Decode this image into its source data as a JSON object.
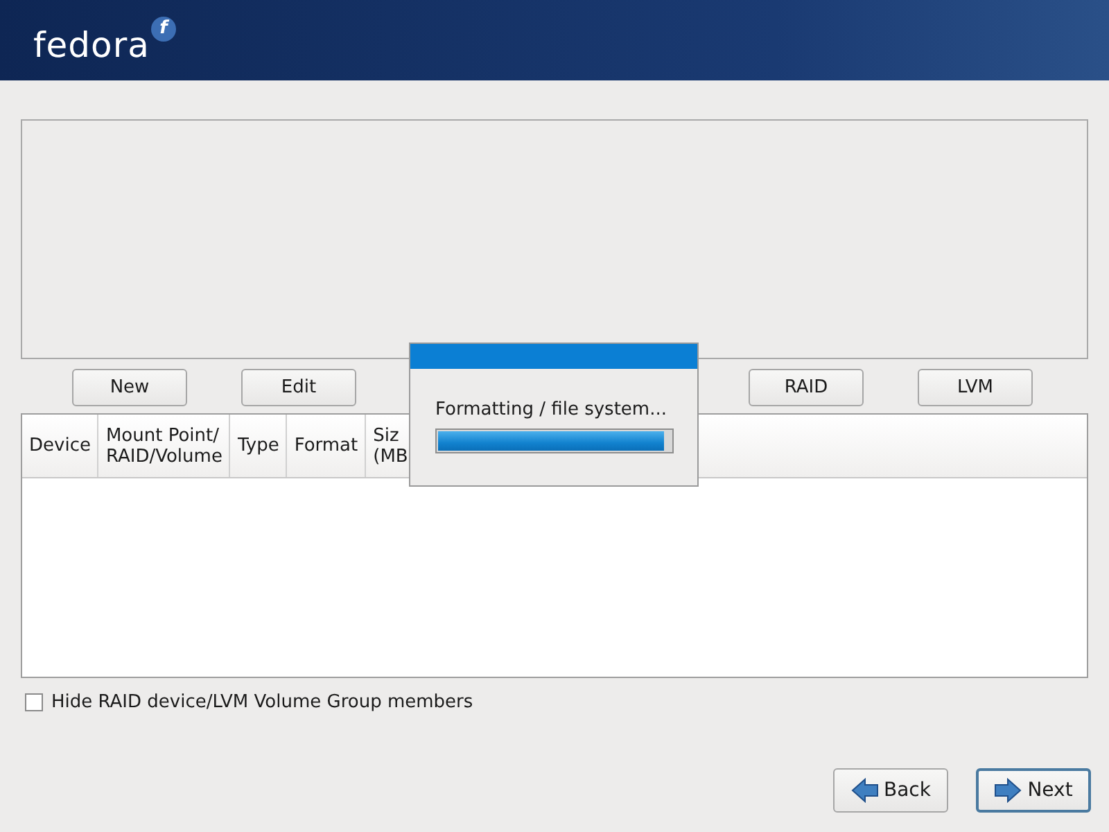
{
  "header": {
    "logo_text": "fedora",
    "logo_mark": "f"
  },
  "partition_buttons_left": [
    {
      "label": "New"
    },
    {
      "label": "Edit"
    }
  ],
  "partition_buttons_right": [
    {
      "label": "RAID"
    },
    {
      "label": "LVM"
    }
  ],
  "table": {
    "columns": [
      {
        "label": "Device"
      },
      {
        "label": "Mount Point/\nRAID/Volume"
      },
      {
        "label": "Type"
      },
      {
        "label": "Format"
      },
      {
        "label": "Siz\n(MB"
      }
    ]
  },
  "hide_members": {
    "label": "Hide RAID device/LVM Volume Group members",
    "checked": false
  },
  "dialog": {
    "message": "Formatting / file system...",
    "level": 0.97
  },
  "nav_buttons": [
    {
      "label": "Back",
      "kind": "back",
      "focused": false
    },
    {
      "label": "Next",
      "kind": "next",
      "focused": true
    }
  ]
}
